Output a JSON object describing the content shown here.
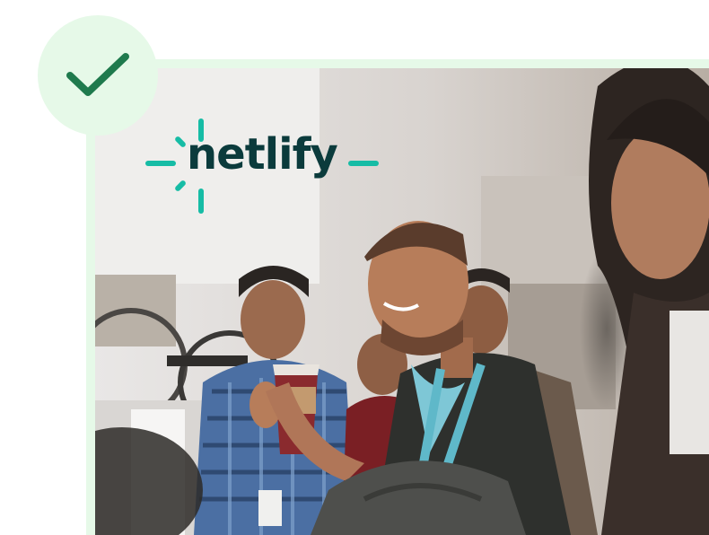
{
  "brand": {
    "wordmark": "netlify",
    "wordmark_color": "#0b3b3c",
    "accent_color": "#16bca5",
    "badge_color": "#e6f9e8",
    "check_color": "#1f7a4d"
  },
  "badge": {
    "icon": "checkmark-icon"
  },
  "photo": {
    "icon": "event-photo"
  }
}
